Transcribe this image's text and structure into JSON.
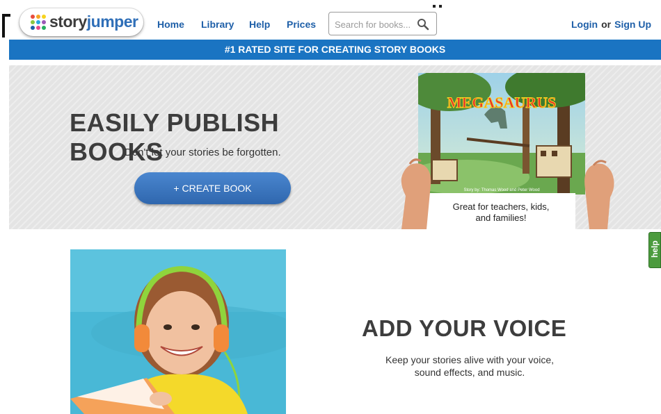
{
  "colors": {
    "accent": "#1a74c2",
    "link": "#1e5fa8",
    "help_tab": "#4c9b3e",
    "hero_bg": "#e4e4e4"
  },
  "header": {
    "logo": {
      "part1": "story",
      "part2": "jumper",
      "icon": "storyjumper-dots-logo"
    },
    "nav": [
      {
        "label": "Home"
      },
      {
        "label": "Library"
      },
      {
        "label": "Help"
      },
      {
        "label": "Prices"
      }
    ],
    "search": {
      "placeholder": "Search for books...",
      "value": "",
      "icon": "search-icon"
    },
    "auth": {
      "login": "Login",
      "or": "or",
      "signup": "Sign Up"
    }
  },
  "banner": {
    "text": "#1 RATED SITE FOR CREATING STORY BOOKS"
  },
  "hero": {
    "title": "EASILY PUBLISH BOOKS",
    "subtitle": "Don't let your stories be forgotten.",
    "cta": "+ CREATE BOOK",
    "book": {
      "cover_title": "MEGASAURUS",
      "cover_credit": "Story by: Thomas Wood and Peter Wood",
      "caption_line1": "Great for teachers, kids,",
      "caption_line2": "and families!"
    }
  },
  "help_tab": {
    "label": "help"
  },
  "voice": {
    "title": "ADD YOUR VOICE",
    "line1": "Keep your stories alive with your voice,",
    "line2": "sound effects, and music."
  }
}
